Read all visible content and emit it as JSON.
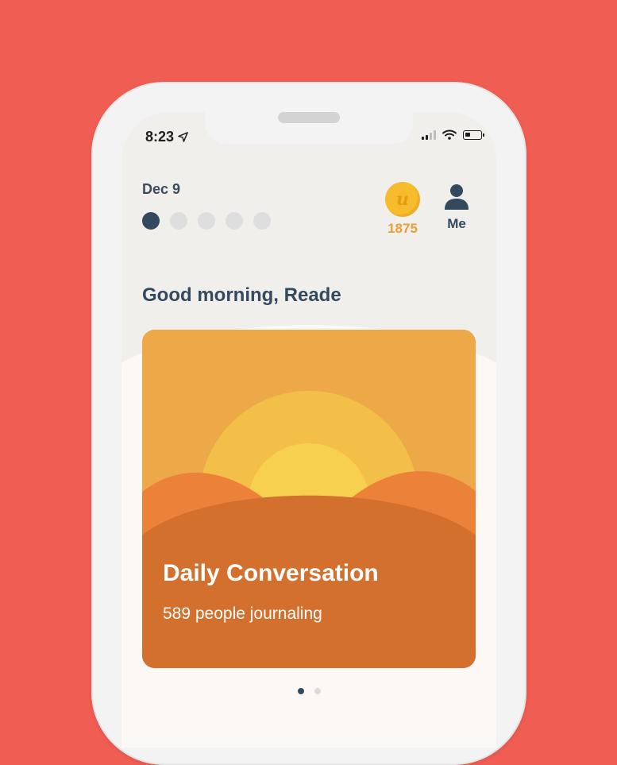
{
  "status_bar": {
    "time": "8:23",
    "location_icon": "location-arrow-icon",
    "signal_icon": "cellular-signal-icon",
    "wifi_icon": "wifi-icon",
    "battery_icon": "battery-icon",
    "battery_level": 0.35
  },
  "header": {
    "date": "Dec 9",
    "progress_dots": {
      "total": 5,
      "active_index": 0
    },
    "coins": {
      "icon": "coin-icon",
      "symbol": "u",
      "count": "1875"
    },
    "profile": {
      "icon": "person-icon",
      "label": "Me"
    }
  },
  "greeting": "Good morning, Reade",
  "card": {
    "title": "Daily Conversation",
    "subtitle": "589 people journaling",
    "illustration": "sunrise-illustration"
  },
  "pager": {
    "total": 2,
    "active_index": 0
  },
  "colors": {
    "background": "#F05D53",
    "primary_text": "#34495E",
    "coin_accent": "#E8A034",
    "card_orange": "#D4702E"
  }
}
